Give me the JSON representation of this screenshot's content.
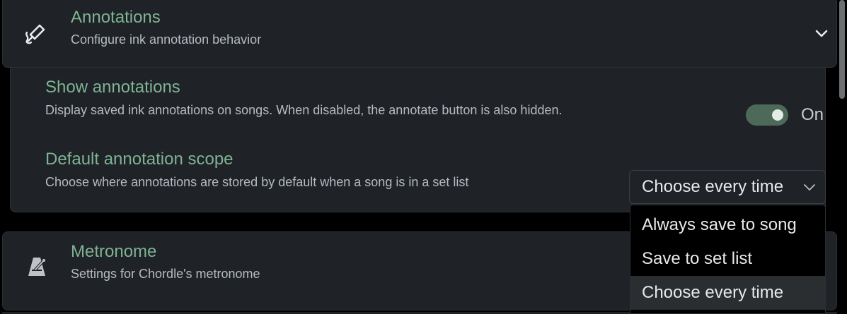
{
  "annotations": {
    "title": "Annotations",
    "subtitle": "Configure ink annotation behavior",
    "icon": "pen-annotation-icon",
    "expand_icon": "chevron-down-icon"
  },
  "show_annotations": {
    "title": "Show annotations",
    "description": "Display saved ink annotations on songs. When disabled, the annotate button is also hidden.",
    "toggle_state": "On",
    "enabled": true
  },
  "default_scope": {
    "title": "Default annotation scope",
    "description": "Choose where annotations are stored by default when a song is in a set list",
    "selected": "Choose every time",
    "options": [
      "Always save to song",
      "Save to set list",
      "Choose every time"
    ]
  },
  "metronome": {
    "title": "Metronome",
    "subtitle": "Settings for Chordle's metronome",
    "icon": "metronome-icon"
  },
  "colors": {
    "accent": "#7fb394",
    "toggle_track": "#4d6a58",
    "card_bg": "#1f2226",
    "page_bg": "#000000"
  }
}
